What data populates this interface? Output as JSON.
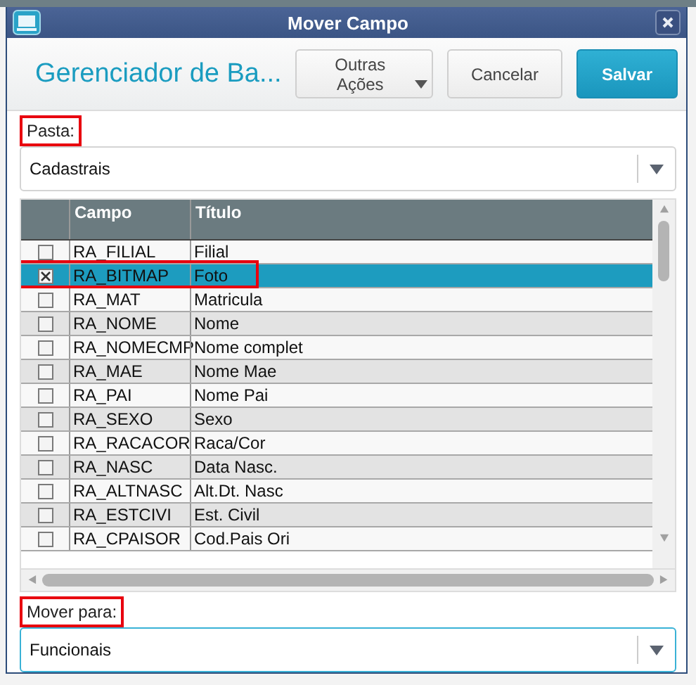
{
  "window": {
    "title": "Mover Campo"
  },
  "header": {
    "title": "Gerenciador de Ba...",
    "buttons": [
      {
        "label": "Outras Ações",
        "kind": "menu"
      },
      {
        "label": "Cancelar",
        "kind": "normal"
      },
      {
        "label": "Salvar",
        "kind": "primary"
      }
    ]
  },
  "pasta": {
    "label": "Pasta:",
    "highlighted": true,
    "value": "Cadastrais"
  },
  "table": {
    "columns": [
      "Campo",
      "Título"
    ],
    "rows": [
      {
        "campo": "RA_FILIAL",
        "titulo": "Filial",
        "checked": false,
        "selected": false,
        "highlighted": false
      },
      {
        "campo": "RA_BITMAP",
        "titulo": "Foto",
        "checked": true,
        "selected": true,
        "highlighted": true
      },
      {
        "campo": "RA_MAT",
        "titulo": "Matricula",
        "checked": false,
        "selected": false,
        "highlighted": false
      },
      {
        "campo": "RA_NOME",
        "titulo": "Nome",
        "checked": false,
        "selected": false,
        "highlighted": false
      },
      {
        "campo": "RA_NOMECMP",
        "titulo": "Nome complet",
        "checked": false,
        "selected": false,
        "highlighted": false
      },
      {
        "campo": "RA_MAE",
        "titulo": "Nome Mae",
        "checked": false,
        "selected": false,
        "highlighted": false
      },
      {
        "campo": "RA_PAI",
        "titulo": "Nome Pai",
        "checked": false,
        "selected": false,
        "highlighted": false
      },
      {
        "campo": "RA_SEXO",
        "titulo": "Sexo",
        "checked": false,
        "selected": false,
        "highlighted": false
      },
      {
        "campo": "RA_RACACOR",
        "titulo": "Raca/Cor",
        "checked": false,
        "selected": false,
        "highlighted": false
      },
      {
        "campo": "RA_NASC",
        "titulo": "Data Nasc.",
        "checked": false,
        "selected": false,
        "highlighted": false
      },
      {
        "campo": "RA_ALTNASC",
        "titulo": "Alt.Dt. Nasc",
        "checked": false,
        "selected": false,
        "highlighted": false
      },
      {
        "campo": "RA_ESTCIVI",
        "titulo": "Est. Civil",
        "checked": false,
        "selected": false,
        "highlighted": false
      },
      {
        "campo": "RA_CPAISOR",
        "titulo": "Cod.Pais Ori",
        "checked": false,
        "selected": false,
        "highlighted": false
      }
    ]
  },
  "mover_para": {
    "label": "Mover para:",
    "highlighted": true,
    "value": "Funcionais"
  }
}
